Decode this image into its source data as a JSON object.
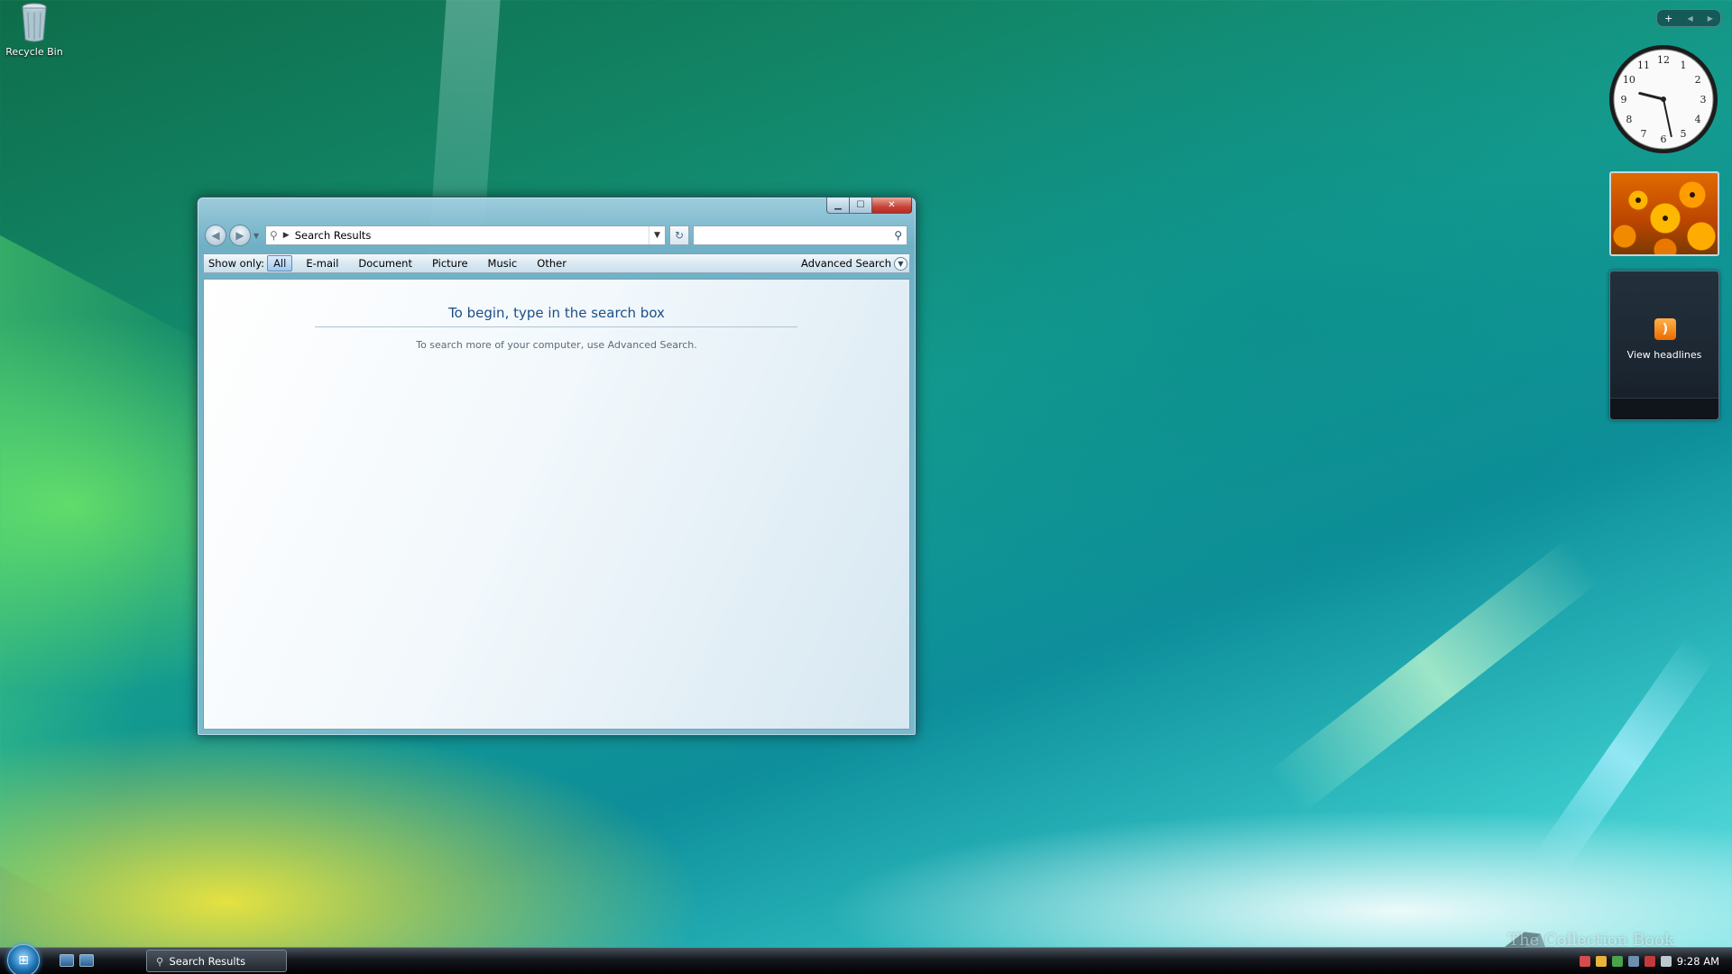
{
  "desktop": {
    "icons": [
      {
        "label": "Recycle Bin",
        "icon": "recycle-bin-icon"
      }
    ],
    "watermark": "The Collection Book"
  },
  "window": {
    "title": "Search Results",
    "address": {
      "breadcrumb": "Search Results"
    },
    "search": {
      "placeholder": "",
      "value": ""
    },
    "filter": {
      "label": "Show only:",
      "items": [
        "All",
        "E-mail",
        "Document",
        "Picture",
        "Music",
        "Other"
      ],
      "selected": "All",
      "advanced_label": "Advanced Search"
    },
    "content": {
      "heading": "To begin, type in the search box",
      "subtext": "To search more of your computer, use Advanced Search."
    }
  },
  "sidebar": {
    "clock": {
      "hour": 9,
      "minute": 28,
      "numbers": [
        "12",
        "1",
        "2",
        "3",
        "4",
        "5",
        "6",
        "7",
        "8",
        "9",
        "10",
        "11"
      ]
    },
    "feeds": {
      "label": "View headlines"
    }
  },
  "taskbar": {
    "tasks": [
      {
        "label": "Search Results"
      }
    ],
    "time": "9:28 AM"
  },
  "colors": {
    "accent": "#1b4f86",
    "close": "#c7453a",
    "rss": "#ec6a00"
  }
}
